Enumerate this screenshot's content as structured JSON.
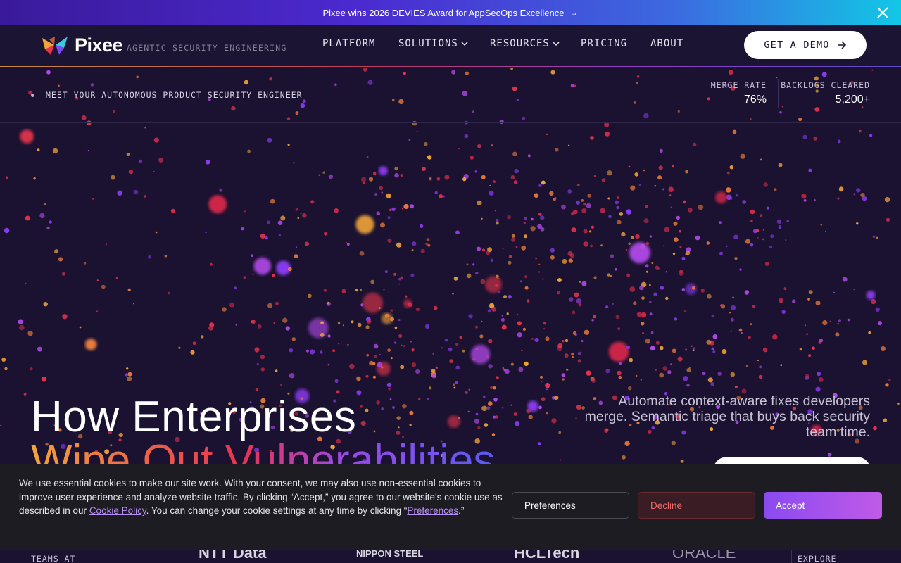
{
  "announcement": {
    "text": "Pixee wins 2026 DEVIES Award for AppSecOps Excellence",
    "arrow": "→",
    "close_icon": "close-icon"
  },
  "header": {
    "logo_text": "Pixee",
    "tagline": "AGENTIC SECURITY ENGINEERING",
    "nav": [
      {
        "label": "PLATFORM",
        "has_dropdown": false
      },
      {
        "label": "SOLUTIONS",
        "has_dropdown": true
      },
      {
        "label": "RESOURCES",
        "has_dropdown": true
      },
      {
        "label": "PRICING",
        "has_dropdown": false
      },
      {
        "label": "ABOUT",
        "has_dropdown": false
      }
    ],
    "cta_label": "GET A DEMO"
  },
  "subbar": {
    "eyebrow": "MEET YOUR AUTONOMOUS PRODUCT SECURITY ENGINEER",
    "stats": [
      {
        "label": "MERGE RATE",
        "value": "76%"
      },
      {
        "label": "BACKLOGS CLEARED",
        "value": "5,200+"
      }
    ]
  },
  "hero": {
    "title_line1": "How Enterprises",
    "title_line2": "Wipe Out Vulnerabilities",
    "copy": "Automate context-aware fixes developers merge. Semantic triage that buys back security team time."
  },
  "cookie": {
    "text_before": "We use essential cookies to make our site work. With your consent, we may also use non-essential cookies to improve user experience and analyze website traffic. By clicking “Accept,” you agree to our website's cookie use as described in our ",
    "policy_link": "Cookie Policy",
    "text_middle": ". You can change your cookie settings at any time by clicking “",
    "preferences_link": "Preferences",
    "text_after": ".”",
    "buttons": {
      "preferences": "Preferences",
      "decline": "Decline",
      "accept": "Accept"
    }
  },
  "logos": {
    "label": "TEAMS AT",
    "clients": [
      "NTT Data",
      "NIPPON STEEL",
      "HCLTech",
      "ORACLE"
    ],
    "explore": "EXPLORE"
  },
  "colors": {
    "background": "#1a1230",
    "accent_orange": "#f2a43a",
    "accent_red": "#e8344e",
    "accent_purple": "#9a4aea",
    "decline_red": "#e86a6a",
    "accept_gradient_start": "#8a4af0",
    "accept_gradient_end": "#c05ae8"
  }
}
